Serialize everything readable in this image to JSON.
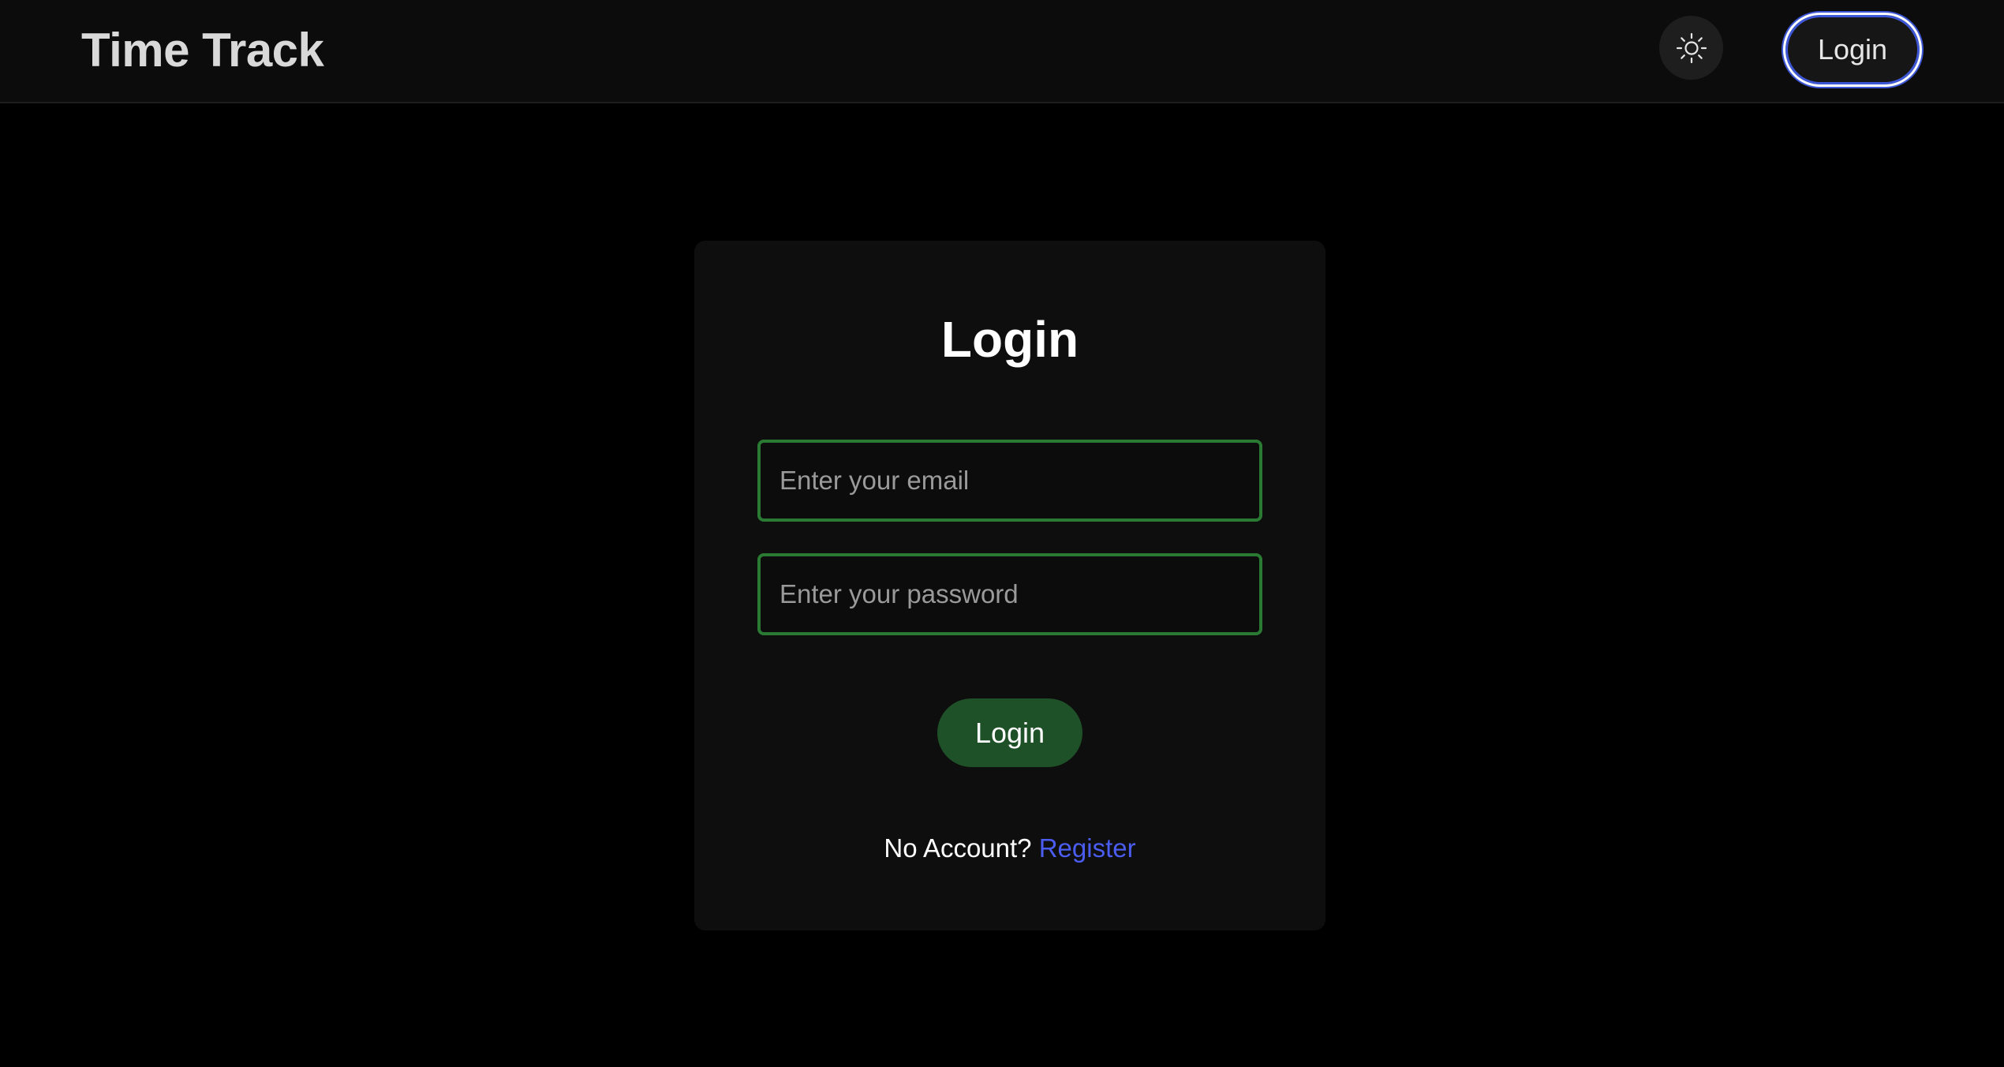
{
  "app": {
    "brand": "Time Track"
  },
  "header": {
    "theme_icon": "sun-icon",
    "login_label": "Login"
  },
  "login_form": {
    "title": "Login",
    "email_placeholder": "Enter your email",
    "email_value": "",
    "password_placeholder": "Enter your password",
    "password_value": "",
    "submit_label": "Login",
    "no_account_text": "No Account?",
    "register_label": "Register"
  },
  "colors": {
    "background": "#000000",
    "navbar": "#0c0c0c",
    "card": "#0e0e0e",
    "input_border": "#2a7a33",
    "submit_bg": "#1f5128",
    "link": "#4b5cf0",
    "focus_ring": "#3d56d6"
  }
}
